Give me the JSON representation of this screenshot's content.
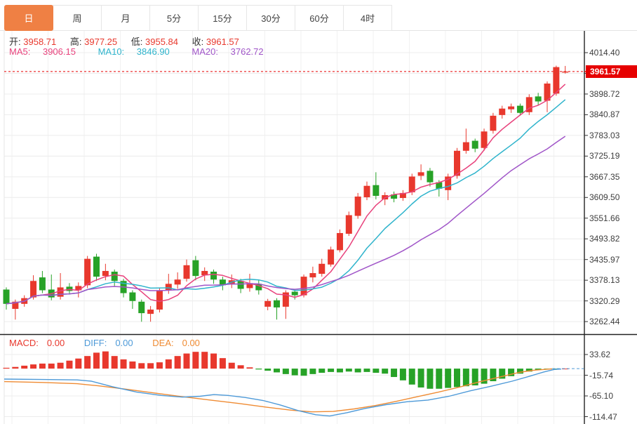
{
  "tabs": {
    "items": [
      {
        "key": "day",
        "label": "日",
        "active": true
      },
      {
        "key": "week",
        "label": "周",
        "active": false
      },
      {
        "key": "month",
        "label": "月",
        "active": false
      },
      {
        "key": "5min",
        "label": "5分",
        "active": false
      },
      {
        "key": "15min",
        "label": "15分",
        "active": false
      },
      {
        "key": "30min",
        "label": "30分",
        "active": false
      },
      {
        "key": "60min",
        "label": "60分",
        "active": false
      },
      {
        "key": "4hour",
        "label": "4时",
        "active": false
      }
    ]
  },
  "ohlc": {
    "open_label": "开:",
    "open_value": "3958.71",
    "high_label": "高:",
    "high_value": "3977.25",
    "low_label": "低:",
    "low_value": "3955.84",
    "close_label": "收:",
    "close_value": "3961.57"
  },
  "ma": {
    "ma5_label": "MA5:",
    "ma5_value": "3906.15",
    "ma10_label": "MA10:",
    "ma10_value": "3846.90",
    "ma20_label": "MA20:",
    "ma20_value": "3762.72"
  },
  "macd_header": {
    "macd_label": "MACD:",
    "macd_value": "0.00",
    "diff_label": "DIFF:",
    "diff_value": "0.00",
    "dea_label": "DEA:",
    "dea_value": "0.00"
  },
  "main_axis": {
    "labels": [
      "4014.40",
      "3898.72",
      "3840.87",
      "3783.03",
      "3725.19",
      "3667.35",
      "3609.50",
      "3551.66",
      "3493.82",
      "3435.97",
      "3378.13",
      "3320.29",
      "3262.44"
    ],
    "current_price": "3961.57"
  },
  "macd_axis": {
    "labels": [
      "33.62",
      "-15.74",
      "-65.10",
      "-114.47"
    ]
  },
  "colors": {
    "up": "#e8382d",
    "down": "#27a227",
    "accent_tab": "#ef8044",
    "ma5": "#e8427c",
    "ma10": "#2fb4cc",
    "ma20": "#a055c8",
    "diff": "#4e9ad8",
    "dea": "#ef8b33",
    "badge": "#e60000",
    "grid": "#ececec",
    "vgrid": "#f1f1f1",
    "axis": "#222222",
    "price_line": "#e60000"
  },
  "chart_data": {
    "type": "candlestick+macd",
    "price_axis": {
      "top_value": 4014.4,
      "step_value": 57.845,
      "bottom_value": 3262.44,
      "current": 3961.57
    },
    "macd_value_axis": {
      "top_value": 33.62,
      "step_value": 49.36,
      "bottom_value": -114.47
    },
    "candles_ohlc_format": [
      "open",
      "close",
      "low",
      "high"
    ],
    "candles": [
      [
        3352,
        3312,
        3296,
        3358
      ],
      [
        3298,
        3318,
        3268,
        3324
      ],
      [
        3312,
        3328,
        3304,
        3336
      ],
      [
        3330,
        3376,
        3324,
        3392
      ],
      [
        3386,
        3350,
        3342,
        3404
      ],
      [
        3352,
        3330,
        3322,
        3394
      ],
      [
        3332,
        3358,
        3324,
        3398
      ],
      [
        3360,
        3348,
        3338,
        3370
      ],
      [
        3350,
        3362,
        3330,
        3372
      ],
      [
        3364,
        3438,
        3356,
        3446
      ],
      [
        3444,
        3388,
        3376,
        3452
      ],
      [
        3390,
        3404,
        3378,
        3424
      ],
      [
        3402,
        3376,
        3362,
        3408
      ],
      [
        3376,
        3342,
        3330,
        3382
      ],
      [
        3344,
        3320,
        3298,
        3350
      ],
      [
        3318,
        3286,
        3262,
        3324
      ],
      [
        3284,
        3296,
        3262,
        3306
      ],
      [
        3296,
        3350,
        3288,
        3358
      ],
      [
        3350,
        3368,
        3340,
        3396
      ],
      [
        3366,
        3380,
        3354,
        3400
      ],
      [
        3382,
        3420,
        3374,
        3436
      ],
      [
        3434,
        3390,
        3378,
        3446
      ],
      [
        3392,
        3404,
        3376,
        3414
      ],
      [
        3402,
        3380,
        3368,
        3408
      ],
      [
        3380,
        3364,
        3350,
        3388
      ],
      [
        3366,
        3378,
        3356,
        3394
      ],
      [
        3376,
        3354,
        3342,
        3382
      ],
      [
        3356,
        3370,
        3346,
        3396
      ],
      [
        3368,
        3350,
        3338,
        3378
      ],
      [
        3304,
        3320,
        3294,
        3326
      ],
      [
        3322,
        3302,
        3268,
        3328
      ],
      [
        3304,
        3344,
        3270,
        3350
      ],
      [
        3346,
        3336,
        3324,
        3354
      ],
      [
        3336,
        3388,
        3330,
        3394
      ],
      [
        3386,
        3398,
        3372,
        3416
      ],
      [
        3396,
        3424,
        3388,
        3438
      ],
      [
        3422,
        3464,
        3416,
        3472
      ],
      [
        3462,
        3510,
        3456,
        3520
      ],
      [
        3508,
        3560,
        3502,
        3570
      ],
      [
        3558,
        3612,
        3550,
        3622
      ],
      [
        3610,
        3642,
        3602,
        3654
      ],
      [
        3644,
        3614,
        3604,
        3680
      ],
      [
        3604,
        3616,
        3588,
        3624
      ],
      [
        3618,
        3606,
        3596,
        3626
      ],
      [
        3608,
        3622,
        3600,
        3630
      ],
      [
        3624,
        3668,
        3616,
        3676
      ],
      [
        3670,
        3680,
        3658,
        3702
      ],
      [
        3684,
        3652,
        3640,
        3692
      ],
      [
        3652,
        3634,
        3612,
        3658
      ],
      [
        3630,
        3668,
        3602,
        3676
      ],
      [
        3670,
        3740,
        3662,
        3748
      ],
      [
        3740,
        3764,
        3732,
        3802
      ],
      [
        3768,
        3746,
        3736,
        3774
      ],
      [
        3748,
        3794,
        3740,
        3802
      ],
      [
        3796,
        3838,
        3788,
        3846
      ],
      [
        3840,
        3858,
        3830,
        3866
      ],
      [
        3856,
        3864,
        3846,
        3872
      ],
      [
        3866,
        3846,
        3838,
        3872
      ],
      [
        3848,
        3890,
        3840,
        3898
      ],
      [
        3892,
        3878,
        3868,
        3902
      ],
      [
        3880,
        3928,
        3848,
        3934
      ],
      [
        3900,
        3974,
        3894,
        3978
      ],
      [
        3958.71,
        3961.57,
        3955.84,
        3977.25
      ]
    ],
    "ma_windows": [
      5,
      10,
      20
    ],
    "macd_histogram": [
      2,
      4,
      7,
      10,
      12,
      12,
      14,
      19,
      24,
      30,
      38,
      41,
      30,
      22,
      17,
      13,
      13,
      15,
      22,
      30,
      36,
      40,
      40,
      36,
      25,
      14,
      8,
      3,
      -2,
      -5,
      -9,
      -13,
      -16,
      -17,
      -13,
      -10,
      -8,
      -9,
      -7,
      -9,
      -8,
      -10,
      -12,
      -20,
      -28,
      -38,
      -45,
      -48,
      -48,
      -46,
      -44,
      -42,
      -40,
      -36,
      -30,
      -24,
      -18,
      -12,
      -7,
      -3,
      -1,
      -0.5,
      0
    ],
    "diff_line": [
      [
        6,
        -25
      ],
      [
        60,
        -26
      ],
      [
        110,
        -27
      ],
      [
        130,
        -30
      ],
      [
        160,
        -43
      ],
      [
        195,
        -56
      ],
      [
        230,
        -64
      ],
      [
        260,
        -68
      ],
      [
        285,
        -66
      ],
      [
        305,
        -62
      ],
      [
        325,
        -64
      ],
      [
        350,
        -69
      ],
      [
        375,
        -76
      ],
      [
        400,
        -87
      ],
      [
        425,
        -100
      ],
      [
        450,
        -110
      ],
      [
        470,
        -113
      ],
      [
        495,
        -105
      ],
      [
        520,
        -95
      ],
      [
        550,
        -86
      ],
      [
        580,
        -79
      ],
      [
        610,
        -75
      ],
      [
        640,
        -66
      ],
      [
        670,
        -53
      ],
      [
        700,
        -42
      ],
      [
        730,
        -30
      ],
      [
        755,
        -18
      ],
      [
        775,
        -8
      ],
      [
        790,
        -2
      ],
      [
        800,
        -1
      ]
    ],
    "dea_line": [
      [
        6,
        -31
      ],
      [
        60,
        -33
      ],
      [
        110,
        -36
      ],
      [
        140,
        -41
      ],
      [
        180,
        -49
      ],
      [
        220,
        -58
      ],
      [
        260,
        -67
      ],
      [
        300,
        -75
      ],
      [
        340,
        -83
      ],
      [
        380,
        -92
      ],
      [
        415,
        -99
      ],
      [
        445,
        -103
      ],
      [
        475,
        -102
      ],
      [
        505,
        -96
      ],
      [
        535,
        -88
      ],
      [
        565,
        -78
      ],
      [
        595,
        -67
      ],
      [
        625,
        -56
      ],
      [
        655,
        -44
      ],
      [
        685,
        -31
      ],
      [
        715,
        -19
      ],
      [
        740,
        -9
      ],
      [
        760,
        -4
      ],
      [
        787,
        -0.5
      ]
    ],
    "zero_dashed_tail": [
      [
        787,
        0
      ],
      [
        832,
        0
      ]
    ]
  }
}
